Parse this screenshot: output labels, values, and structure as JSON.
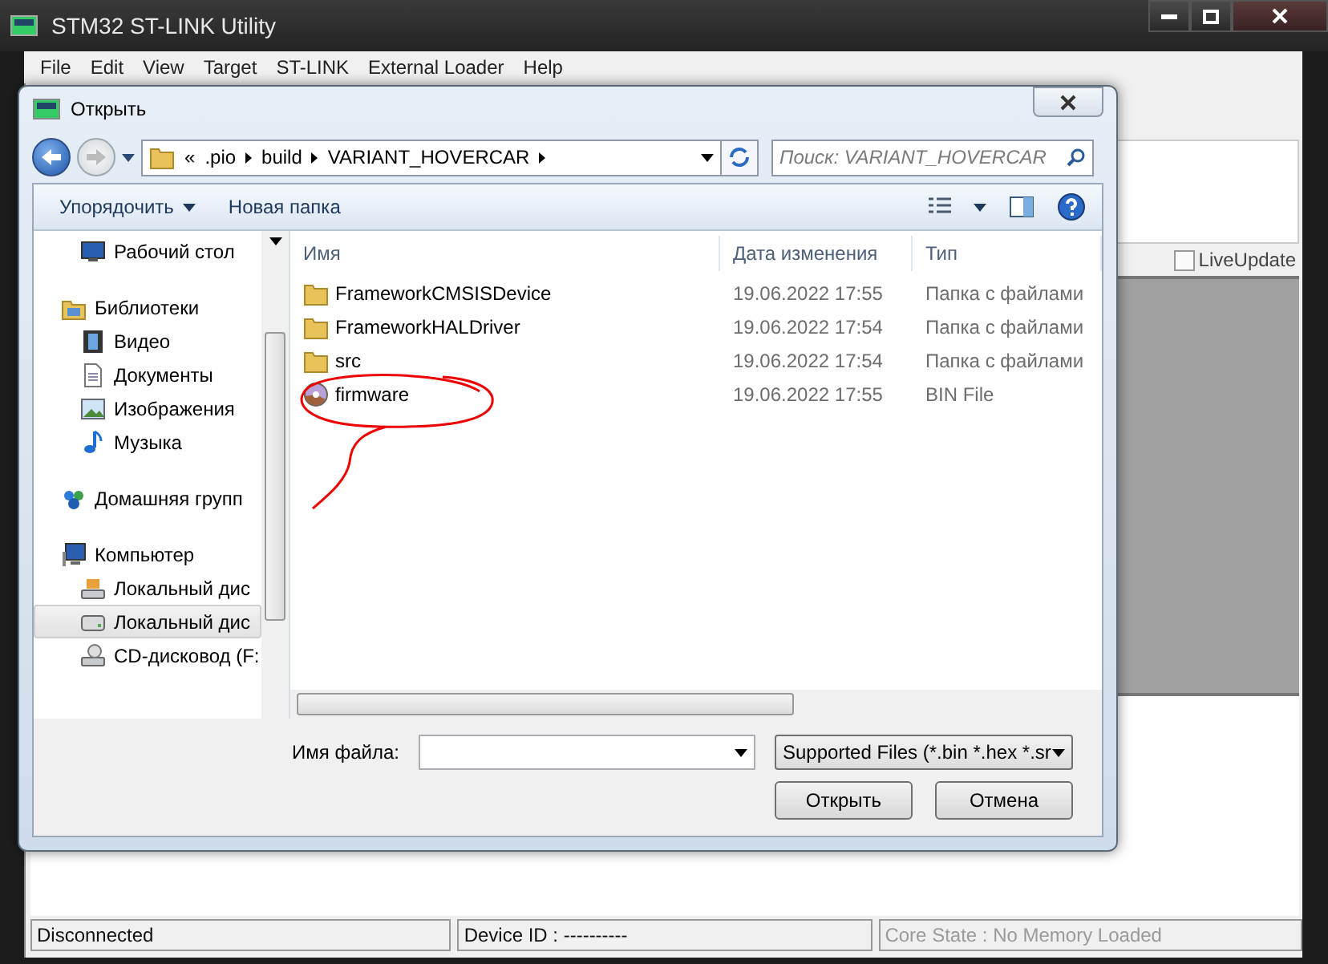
{
  "window": {
    "title": "STM32 ST-LINK Utility"
  },
  "menu": [
    "File",
    "Edit",
    "View",
    "Target",
    "ST-LINK",
    "External Loader",
    "Help"
  ],
  "live_update": {
    "label": "LiveUpdate",
    "checked": false
  },
  "status_bar": [
    {
      "text": "Disconnected",
      "disabled": false
    },
    {
      "text": "Device ID : ----------",
      "disabled": false
    },
    {
      "text": "Core State : No Memory Loaded",
      "disabled": true
    }
  ],
  "dialog": {
    "title": "Открыть",
    "address": {
      "overflow": "«",
      "path": [
        ".pio",
        "build",
        "VARIANT_HOVERCAR"
      ]
    },
    "search": {
      "placeholder": "Поиск: VARIANT_HOVERCAR"
    },
    "toolbar": [
      {
        "label": "Упорядочить",
        "dropdown": true
      },
      {
        "label": "Новая папка",
        "dropdown": false
      }
    ],
    "nav": [
      {
        "label": "Рабочий стол",
        "kind": "desktop",
        "selected": false
      },
      {
        "label": "Библиотеки",
        "kind": "library",
        "selected": false,
        "children": [
          {
            "label": "Видео",
            "kind": "video",
            "selected": false
          },
          {
            "label": "Документы",
            "kind": "documents",
            "selected": false
          },
          {
            "label": "Изображения",
            "kind": "pictures",
            "selected": false
          },
          {
            "label": "Музыка",
            "kind": "music",
            "selected": false
          }
        ]
      },
      {
        "label": "Домашняя групп",
        "kind": "homegroup",
        "selected": false
      },
      {
        "label": "Компьютер",
        "kind": "computer",
        "selected": false,
        "children": [
          {
            "label": "Локальный дис",
            "kind": "system-drive",
            "selected": false
          },
          {
            "label": "Локальный дис",
            "kind": "drive",
            "selected": true
          },
          {
            "label": "CD-дисковод (F:",
            "kind": "cdrom",
            "selected": false
          }
        ]
      }
    ],
    "columns": [
      "Имя",
      "Дата изменения",
      "Тип"
    ],
    "files": [
      {
        "name": "FrameworkCMSISDevice",
        "date": "19.06.2022 17:55",
        "type": "Папка с файлами",
        "kind": "folder"
      },
      {
        "name": "FrameworkHALDriver",
        "date": "19.06.2022 17:54",
        "type": "Папка с файлами",
        "kind": "folder"
      },
      {
        "name": "src",
        "date": "19.06.2022 17:54",
        "type": "Папка с файлами",
        "kind": "folder"
      },
      {
        "name": "firmware",
        "date": "19.06.2022 17:55",
        "type": "BIN File",
        "kind": "disc-file"
      }
    ],
    "filename_label": "Имя файла:",
    "filter": "Supported Files (*.bin *.hex *.sr",
    "buttons": [
      "Открыть",
      "Отмена"
    ]
  }
}
